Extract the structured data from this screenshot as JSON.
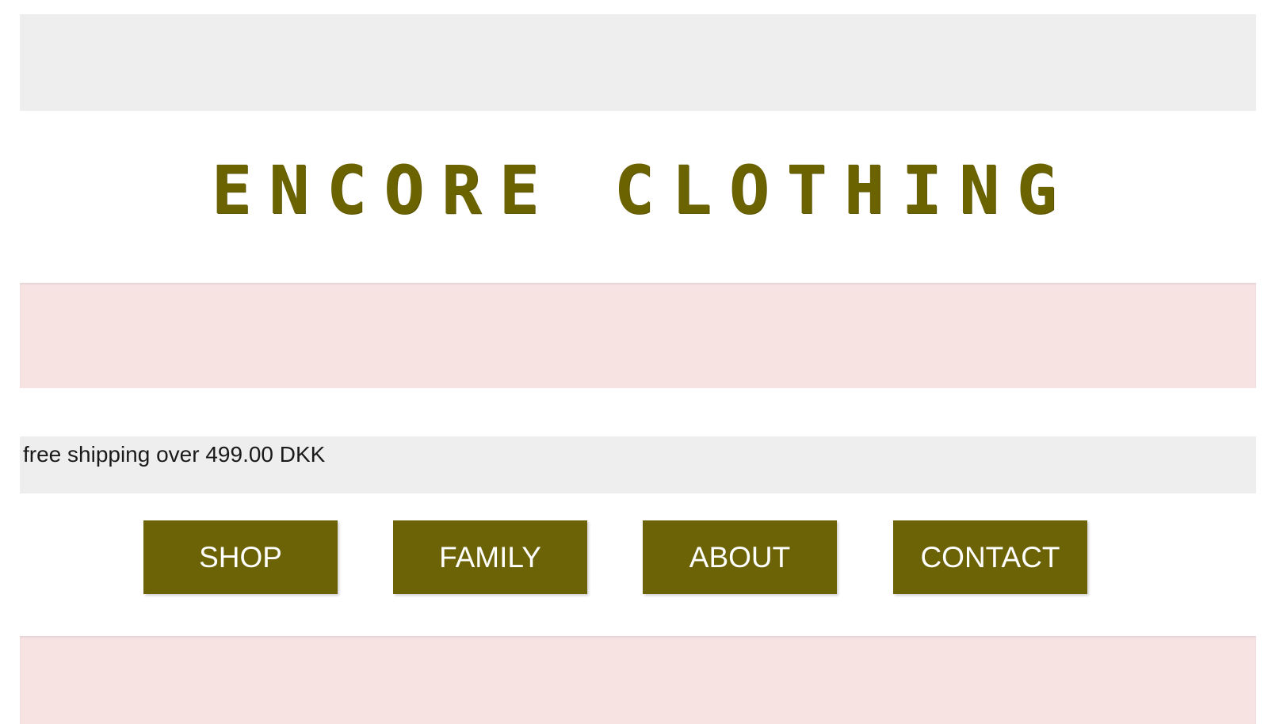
{
  "header": {
    "brand_title": "ENCORE CLOTHING"
  },
  "announcement": {
    "text": "free shipping over 499.00 DKK"
  },
  "nav": {
    "items": [
      {
        "label": "SHOP"
      },
      {
        "label": "FAMILY"
      },
      {
        "label": "ABOUT"
      },
      {
        "label": "CONTACT"
      }
    ]
  },
  "colors": {
    "brand_olive": "#6b6306",
    "band_grey": "#eeeeee",
    "band_pink": "#f6e3e2"
  }
}
